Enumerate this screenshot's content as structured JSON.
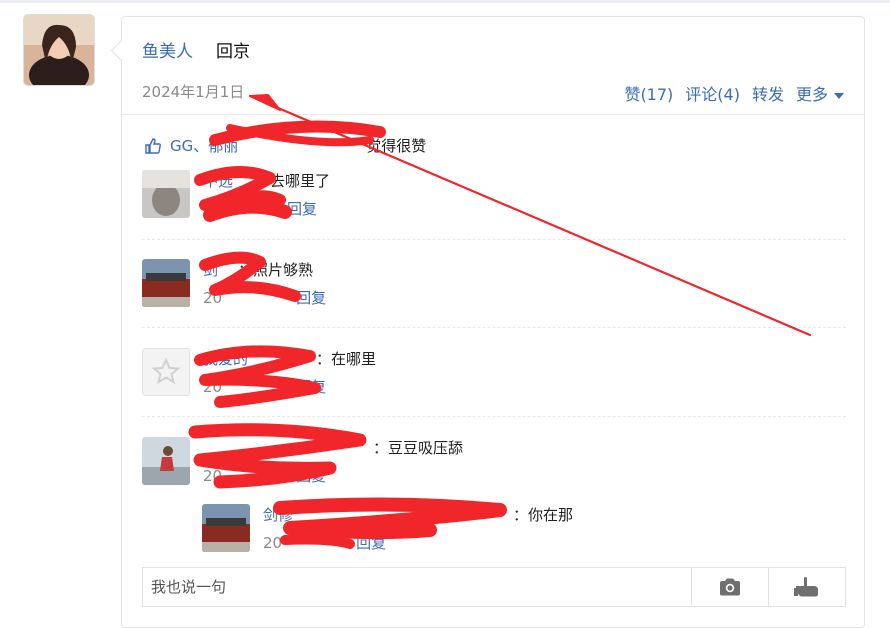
{
  "post": {
    "user": "鱼美人",
    "text": "回京",
    "date": "2024年1月1日"
  },
  "actions": {
    "like": "赞(17)",
    "comment": "评论(4)",
    "repost": "转发",
    "more": "更多"
  },
  "likes": {
    "names": "GG、郁丽",
    "suffix": "觉得很赞"
  },
  "comments": [
    {
      "user": "不选",
      "text": "：去哪里了",
      "date": "",
      "reply": "回复"
    },
    {
      "user": "剑",
      "text": "：照片够熟",
      "date": "20",
      "reply": "回复"
    },
    {
      "user": "我爱的",
      "text": "：在哪里",
      "date": "20",
      "reply": "回复"
    },
    {
      "user": "",
      "text": "：豆豆吸压舔",
      "date": "20",
      "reply": "回复"
    }
  ],
  "sub_comment": {
    "user": "剑修",
    "text": "：你在那",
    "date": "20",
    "reply": "回复"
  },
  "composer": {
    "placeholder": "我也说一句"
  },
  "icons": [
    "thumbs-up-icon",
    "camera-icon",
    "hand-pointer-icon"
  ],
  "colors": {
    "link": "#3b6db6",
    "scribble": "#f0262a"
  }
}
